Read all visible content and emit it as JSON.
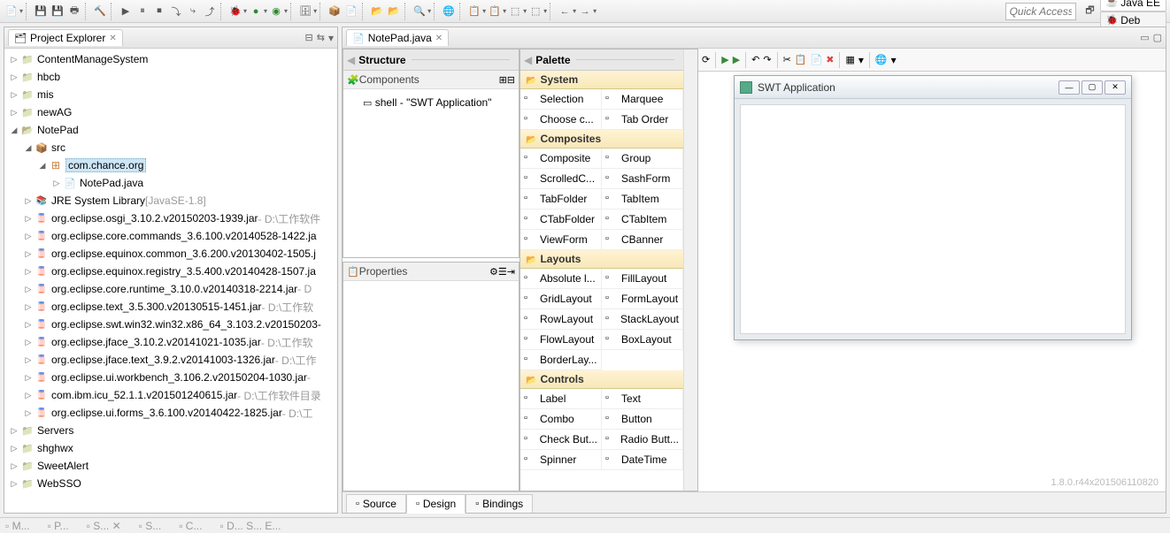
{
  "toolbar": {
    "quick_access_placeholder": "Quick Access"
  },
  "perspectives": [
    {
      "icon": "☕",
      "label": "Java EE",
      "active": true
    },
    {
      "icon": "🐞",
      "label": "Deb"
    }
  ],
  "explorer": {
    "title": "Project Explorer",
    "tree": [
      {
        "depth": 0,
        "expander": "▷",
        "icon": "folder-icon",
        "label": "ContentManageSystem"
      },
      {
        "depth": 0,
        "expander": "▷",
        "icon": "folder-icon",
        "label": "hbcb"
      },
      {
        "depth": 0,
        "expander": "▷",
        "icon": "folder-icon",
        "label": "mis"
      },
      {
        "depth": 0,
        "expander": "▷",
        "icon": "folder-icon",
        "label": "newAG"
      },
      {
        "depth": 0,
        "expander": "◢",
        "icon": "folder-open",
        "label": "NotePad"
      },
      {
        "depth": 1,
        "expander": "◢",
        "icon": "src-icon",
        "label": "src"
      },
      {
        "depth": 2,
        "expander": "◢",
        "icon": "pkg-icon",
        "label": "com.chance.org",
        "selected": true
      },
      {
        "depth": 3,
        "expander": "▷",
        "icon": "java-icon",
        "label": "NotePad.java"
      },
      {
        "depth": 1,
        "expander": "▷",
        "icon": "lib-icon",
        "label": "JRE System Library",
        "suffix": "[JavaSE-1.8]"
      },
      {
        "depth": 1,
        "expander": "▷",
        "icon": "jar-icon",
        "label": "org.eclipse.osgi_3.10.2.v20150203-1939.jar",
        "suffix": "- D:\\工作软件"
      },
      {
        "depth": 1,
        "expander": "▷",
        "icon": "jar-icon",
        "label": "org.eclipse.core.commands_3.6.100.v20140528-1422.ja"
      },
      {
        "depth": 1,
        "expander": "▷",
        "icon": "jar-icon",
        "label": "org.eclipse.equinox.common_3.6.200.v20130402-1505.j"
      },
      {
        "depth": 1,
        "expander": "▷",
        "icon": "jar-icon",
        "label": "org.eclipse.equinox.registry_3.5.400.v20140428-1507.ja"
      },
      {
        "depth": 1,
        "expander": "▷",
        "icon": "jar-icon",
        "label": "org.eclipse.core.runtime_3.10.0.v20140318-2214.jar",
        "suffix": "- D"
      },
      {
        "depth": 1,
        "expander": "▷",
        "icon": "jar-icon",
        "label": "org.eclipse.text_3.5.300.v20130515-1451.jar",
        "suffix": "- D:\\工作软"
      },
      {
        "depth": 1,
        "expander": "▷",
        "icon": "jar-icon",
        "label": "org.eclipse.swt.win32.win32.x86_64_3.103.2.v20150203-"
      },
      {
        "depth": 1,
        "expander": "▷",
        "icon": "jar-icon",
        "label": "org.eclipse.jface_3.10.2.v20141021-1035.jar",
        "suffix": "- D:\\工作软"
      },
      {
        "depth": 1,
        "expander": "▷",
        "icon": "jar-icon",
        "label": "org.eclipse.jface.text_3.9.2.v20141003-1326.jar",
        "suffix": "- D:\\工作"
      },
      {
        "depth": 1,
        "expander": "▷",
        "icon": "jar-icon",
        "label": "org.eclipse.ui.workbench_3.106.2.v20150204-1030.jar",
        "suffix": "-"
      },
      {
        "depth": 1,
        "expander": "▷",
        "icon": "jar-icon",
        "label": "com.ibm.icu_52.1.1.v201501240615.jar",
        "suffix": "- D:\\工作软件目录"
      },
      {
        "depth": 1,
        "expander": "▷",
        "icon": "jar-icon",
        "label": "org.eclipse.ui.forms_3.6.100.v20140422-1825.jar",
        "suffix": "- D:\\工"
      },
      {
        "depth": 0,
        "expander": "▷",
        "icon": "folder-icon",
        "label": "Servers"
      },
      {
        "depth": 0,
        "expander": "▷",
        "icon": "folder-icon",
        "label": "shghwx"
      },
      {
        "depth": 0,
        "expander": "▷",
        "icon": "folder-icon",
        "label": "SweetAlert"
      },
      {
        "depth": 0,
        "expander": "▷",
        "icon": "folder-icon",
        "label": "WebSSO"
      }
    ]
  },
  "editor": {
    "tab_label": "NotePad.java",
    "structure_title": "Structure",
    "components_title": "Components",
    "component_item": "shell - \"SWT Application\"",
    "properties_title": "Properties",
    "palette_title": "Palette",
    "version": "1.8.0.r44x201506110820",
    "bottom_tabs": [
      {
        "label": "Source"
      },
      {
        "label": "Design",
        "active": true
      },
      {
        "label": "Bindings"
      }
    ]
  },
  "palette": {
    "categories": [
      {
        "name": "System",
        "items": [
          {
            "label": "Selection"
          },
          {
            "label": "Marquee"
          },
          {
            "label": "Choose c..."
          },
          {
            "label": "Tab Order"
          }
        ]
      },
      {
        "name": "Composites",
        "items": [
          {
            "label": "Composite"
          },
          {
            "label": "Group"
          },
          {
            "label": "ScrolledC..."
          },
          {
            "label": "SashForm"
          },
          {
            "label": "TabFolder"
          },
          {
            "label": "TabItem"
          },
          {
            "label": "CTabFolder"
          },
          {
            "label": "CTabItem"
          },
          {
            "label": "ViewForm"
          },
          {
            "label": "CBanner"
          }
        ]
      },
      {
        "name": "Layouts",
        "items": [
          {
            "label": "Absolute l..."
          },
          {
            "label": "FillLayout"
          },
          {
            "label": "GridLayout"
          },
          {
            "label": "FormLayout"
          },
          {
            "label": "RowLayout"
          },
          {
            "label": "StackLayout"
          },
          {
            "label": "FlowLayout"
          },
          {
            "label": "BoxLayout"
          },
          {
            "label": "BorderLay..."
          }
        ]
      },
      {
        "name": "Controls",
        "items": [
          {
            "label": "Label"
          },
          {
            "label": "Text"
          },
          {
            "label": "Combo"
          },
          {
            "label": "Button"
          },
          {
            "label": "Check But..."
          },
          {
            "label": "Radio Butt..."
          },
          {
            "label": "Spinner"
          },
          {
            "label": "DateTime"
          }
        ]
      }
    ]
  },
  "swt_window": {
    "title": "SWT Application"
  }
}
